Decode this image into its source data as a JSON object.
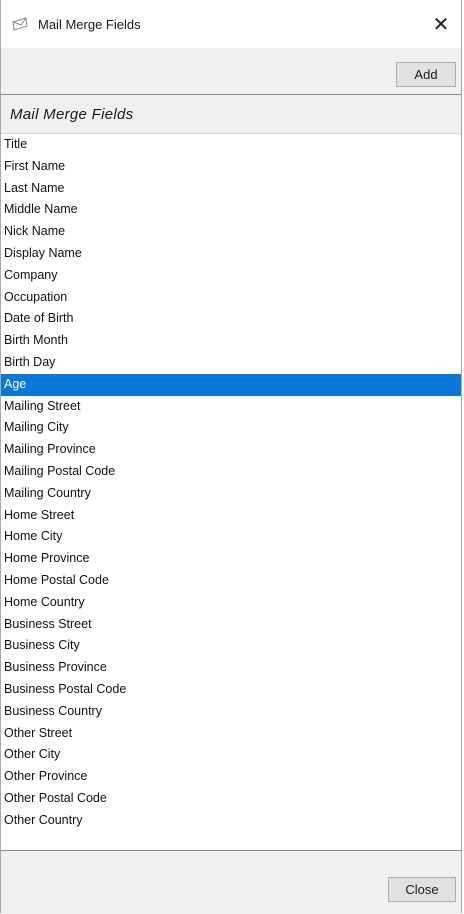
{
  "window": {
    "title": "Mail Merge Fields",
    "title_icon": "envelope-icon",
    "close_glyph": "✕"
  },
  "toolbar": {
    "add_label": "Add"
  },
  "panel": {
    "title": "Mail Merge Fields"
  },
  "fields": [
    "Title",
    "First Name",
    "Last Name",
    "Middle Name",
    "Nick Name",
    "Display Name",
    "Company",
    "Occupation",
    "Date of Birth",
    "Birth Month",
    "Birth Day",
    "Age",
    "Mailing Street",
    "Mailing City",
    "Mailing Province",
    "Mailing Postal Code",
    "Mailing Country",
    "Home Street",
    "Home City",
    "Home Province",
    "Home Postal Code",
    "Home Country",
    "Business Street",
    "Business City",
    "Business Province",
    "Business Postal Code",
    "Business Country",
    "Other Street",
    "Other City",
    "Other Province",
    "Other Postal Code",
    "Other Country"
  ],
  "selected_field": "Age",
  "footer": {
    "close_label": "Close"
  },
  "colors": {
    "selection": "#0a78d7",
    "chrome": "#f0f0f0"
  }
}
